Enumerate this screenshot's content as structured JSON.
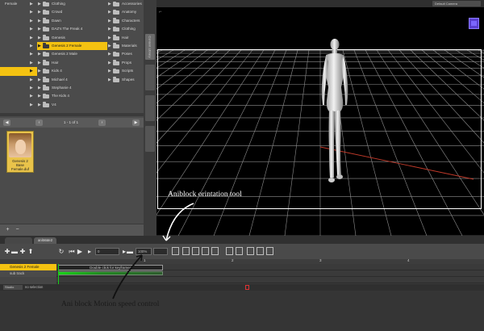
{
  "library": {
    "col1": [
      {
        "label": "Female",
        "arrow": true,
        "selected": false
      },
      {
        "label": "",
        "arrow": true,
        "selected": false
      },
      {
        "label": "",
        "arrow": true,
        "selected": false
      },
      {
        "label": "",
        "arrow": true,
        "selected": false
      },
      {
        "label": "",
        "arrow": true,
        "selected": false
      },
      {
        "label": "",
        "arrow": true,
        "selected": false
      },
      {
        "label": "",
        "arrow": true,
        "selected": false
      },
      {
        "label": "",
        "arrow": true,
        "selected": false
      },
      {
        "label": "",
        "arrow": true,
        "selected": true
      },
      {
        "label": "",
        "arrow": true,
        "selected": false
      },
      {
        "label": "",
        "arrow": true,
        "selected": false
      },
      {
        "label": "",
        "arrow": true,
        "selected": false
      },
      {
        "label": "",
        "arrow": true,
        "selected": false
      }
    ],
    "col2": [
      {
        "label": "Clothing",
        "selected": false
      },
      {
        "label": "Crowd",
        "selected": false
      },
      {
        "label": "Dawn",
        "selected": false
      },
      {
        "label": "DAZ's The Freak 4",
        "selected": false
      },
      {
        "label": "Genesis",
        "selected": false
      },
      {
        "label": "Genesis 2 Female",
        "selected": true
      },
      {
        "label": "Genesis 2 Male",
        "selected": false
      },
      {
        "label": "Hair",
        "selected": false
      },
      {
        "label": "Kids 4",
        "selected": false
      },
      {
        "label": "Michael 4",
        "selected": false
      },
      {
        "label": "Stephanie 4",
        "selected": false
      },
      {
        "label": "The Kids 4",
        "selected": false
      },
      {
        "label": "V4",
        "selected": false
      }
    ],
    "col3": [
      {
        "label": "Accessories"
      },
      {
        "label": "Anatomy"
      },
      {
        "label": "Characters"
      },
      {
        "label": "Clothing"
      },
      {
        "label": "Hair"
      },
      {
        "label": "Materials"
      },
      {
        "label": "Poses"
      },
      {
        "label": "Props"
      },
      {
        "label": "Scripts"
      },
      {
        "label": "Shapes"
      }
    ],
    "pager_text": "1 - 1 of 1",
    "thumbnail_label": "Genesis 2 Base\nFemale.duf",
    "side_tabs": [
      "Content Library",
      "",
      "",
      ""
    ]
  },
  "viewport": {
    "camera_label": "Default Camera",
    "grid_color": "#8f8f8f",
    "frame_color": "#ffffff"
  },
  "timeline": {
    "tabs": [
      "",
      "aniMate2"
    ],
    "speed_value": "100%",
    "frame_value": "0",
    "ruler_numbers": [
      "1",
      "2",
      "3",
      "4"
    ],
    "tracks": [
      {
        "label": "Genesis 2 Female",
        "selected": true
      },
      {
        "label": "sub track",
        "selected": false
      },
      {
        "label": "",
        "selected": false
      },
      {
        "label": "",
        "selected": false
      }
    ],
    "aniblock_text": "Double click for keyframes",
    "studio_label": "Studio",
    "status_text": "no selection"
  },
  "annotations": {
    "orientation": "Aniblock orintation tool",
    "speed": "Ani block Motion speed control"
  }
}
